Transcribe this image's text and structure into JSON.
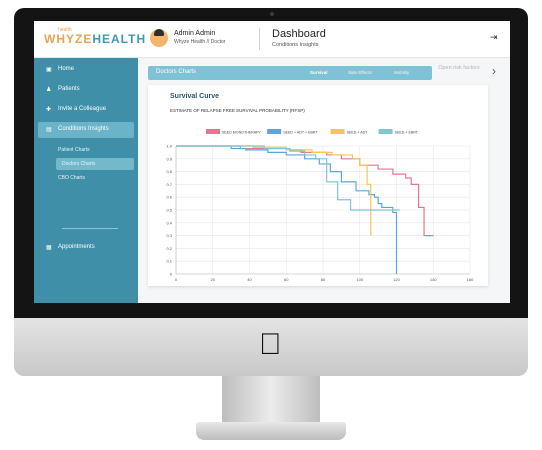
{
  "app": {
    "logo_prefix": "WHYZE",
    "logo_suffix": "HEALTH",
    "logo_tagline": "health"
  },
  "header": {
    "user_name": "Admin Admin",
    "user_role": "Whyze Health // Doctor",
    "title": "Dashboard",
    "subtitle": "Conditions Insights",
    "logout_icon": "logout-icon"
  },
  "sidebar": {
    "items": [
      {
        "label": "Home",
        "icon": "home-icon",
        "glyph": "▣"
      },
      {
        "label": "Patients",
        "icon": "user-icon",
        "glyph": "♟"
      },
      {
        "label": "Invite a Colleague",
        "icon": "add-user-icon",
        "glyph": "✚"
      },
      {
        "label": "Conditions Insights",
        "icon": "chart-icon",
        "glyph": "▤"
      },
      {
        "label": "Appointments",
        "icon": "calendar-icon",
        "glyph": "▦"
      }
    ],
    "subitems": [
      {
        "label": "Patient Charts"
      },
      {
        "label": "Doctors Charts"
      },
      {
        "label": "CBO Charts"
      }
    ]
  },
  "tabs": {
    "main": "Doctors Charts",
    "items": [
      "Survival",
      "Side Effects",
      "Mobility"
    ],
    "extra": "Open risk factors"
  },
  "chart_data": {
    "type": "line",
    "title": "Survival Curve",
    "subtitle": "ESTIMATE OF RELAPSE FREE SURVIVAL PROBABILITY (RFSP)",
    "xlabel": "",
    "ylabel": "",
    "xlim": [
      0,
      160
    ],
    "ylim": [
      0,
      1.0
    ],
    "xticks": [
      0,
      20,
      40,
      60,
      80,
      100,
      120,
      140,
      160
    ],
    "yticks": [
      0,
      0.1,
      0.2,
      0.3,
      0.4,
      0.5,
      0.6,
      0.7,
      0.8,
      0.9,
      1.0
    ],
    "grid": true,
    "legend_position": "top",
    "series": [
      {
        "name": "SEED MONOTHERAPY",
        "color": "#e8758f",
        "x": [
          0,
          35,
          60,
          68,
          82,
          90,
          100,
          110,
          118,
          125,
          128,
          132,
          135,
          140
        ],
        "y": [
          1.0,
          0.98,
          0.97,
          0.95,
          0.93,
          0.9,
          0.85,
          0.82,
          0.78,
          0.75,
          0.7,
          0.52,
          0.3,
          0.3
        ]
      },
      {
        "name": "SEED + ADT + EBRT",
        "color": "#5fa5dc",
        "x": [
          0,
          30,
          38,
          50,
          60,
          70,
          78,
          84,
          90,
          98,
          105,
          108,
          110,
          112,
          118,
          120
        ],
        "y": [
          1.0,
          0.98,
          0.97,
          0.95,
          0.93,
          0.9,
          0.86,
          0.8,
          0.72,
          0.65,
          0.62,
          0.6,
          0.55,
          0.52,
          0.48,
          0.0
        ]
      },
      {
        "name": "SEED + ADT",
        "color": "#f3c65d",
        "x": [
          0,
          42,
          60,
          74,
          85,
          96,
          100,
          104,
          106
        ],
        "y": [
          1.0,
          0.99,
          0.97,
          0.95,
          0.93,
          0.9,
          0.85,
          0.7,
          0.3
        ]
      },
      {
        "name": "SEED + EBRT",
        "color": "#7fc6d2",
        "x": [
          0,
          48,
          62,
          70,
          76,
          82,
          88,
          95,
          106,
          122
        ],
        "y": [
          1.0,
          0.98,
          0.96,
          0.93,
          0.9,
          0.72,
          0.58,
          0.5,
          0.5,
          0.5
        ]
      }
    ]
  }
}
